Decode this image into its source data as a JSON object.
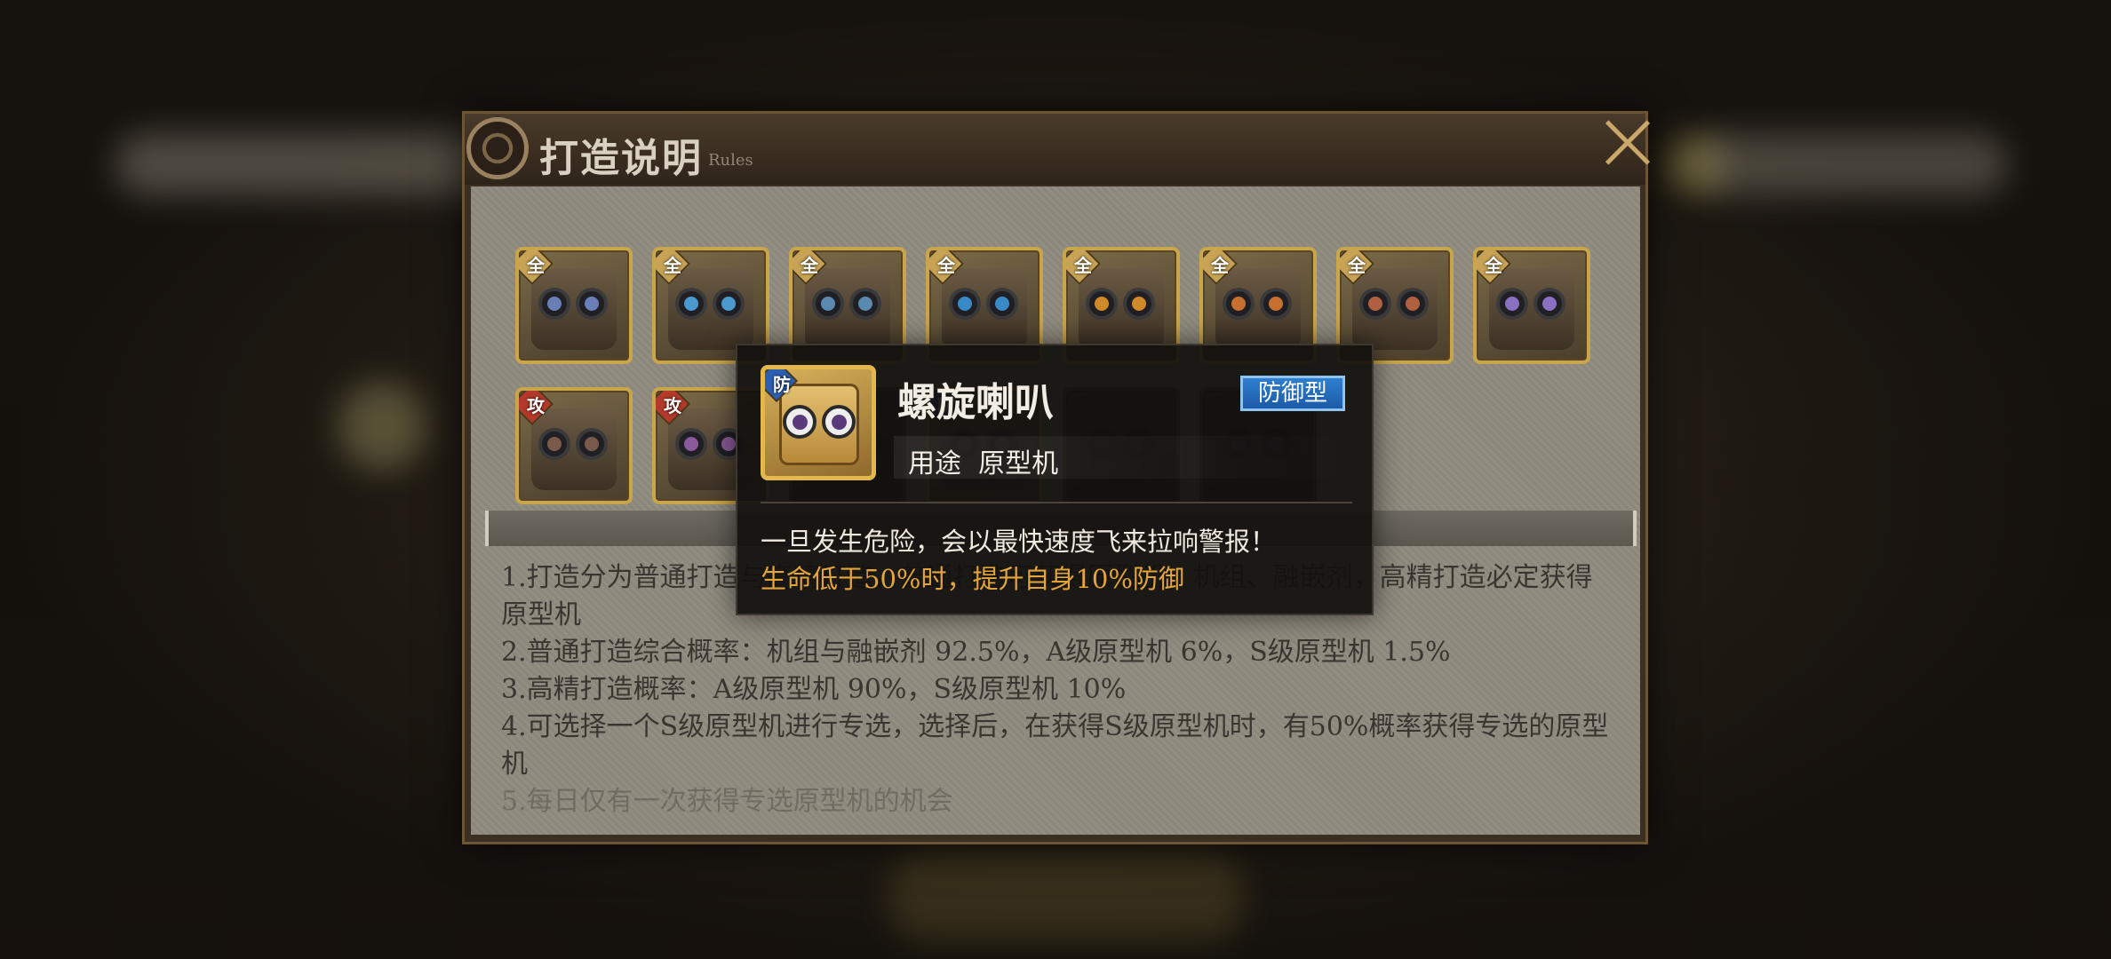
{
  "panel": {
    "title": "打造说明",
    "subtitle": "Rules"
  },
  "cards": [
    {
      "tag": "全",
      "tag_type": "all",
      "eye": "#6a7fb8"
    },
    {
      "tag": "全",
      "tag_type": "all",
      "eye": "#4a9ad0"
    },
    {
      "tag": "全",
      "tag_type": "all",
      "eye": "#5a8ab0"
    },
    {
      "tag": "全",
      "tag_type": "all",
      "eye": "#3a8ac8"
    },
    {
      "tag": "全",
      "tag_type": "all",
      "eye": "#d08a2a"
    },
    {
      "tag": "全",
      "tag_type": "all",
      "eye": "#c87030"
    },
    {
      "tag": "全",
      "tag_type": "all",
      "eye": "#b06040"
    },
    {
      "tag": "全",
      "tag_type": "all",
      "eye": "#8a70c0"
    },
    {
      "tag": "攻",
      "tag_type": "atk",
      "eye": "#7a5a4a"
    },
    {
      "tag": "攻",
      "tag_type": "atk",
      "eye": "#8a5a9a"
    },
    {
      "tag": "",
      "tag_type": "hidden",
      "eye": "#555"
    },
    {
      "tag": "防",
      "tag_type": "def",
      "eye": "#555"
    },
    {
      "tag": "",
      "tag_type": "hidden",
      "eye": "#555"
    },
    {
      "tag": "",
      "tag_type": "hidden",
      "eye": "#8a4aa0"
    }
  ],
  "rules": [
    "1.打造分为普通打造与高精打造，普通打造可获得原型机、机组、融嵌剂，高精打造必定获得原型机",
    "2.普通打造综合概率：机组与融嵌剂 92.5%，A级原型机 6%，S级原型机 1.5%",
    "3.高精打造概率：A级原型机 90%，S级原型机 10%",
    "4.可选择一个S级原型机进行专选，选择后，在获得S级原型机时，有50%概率获得专选的原型机",
    "5.每日仅有一次获得专选原型机的机会"
  ],
  "popup": {
    "tag": "防",
    "name": "螺旋喇叭",
    "type_badge": "防御型",
    "use_label": "用途",
    "use_value": "原型机",
    "description": "一旦发生危险，会以最快速度飞来拉响警报！",
    "effect": "生命低于50%时，提升自身10%防御"
  },
  "colors": {
    "effect_text": "#e3a53a",
    "type_badge": "#2f7fd0",
    "card_border": "#c9a54c"
  }
}
